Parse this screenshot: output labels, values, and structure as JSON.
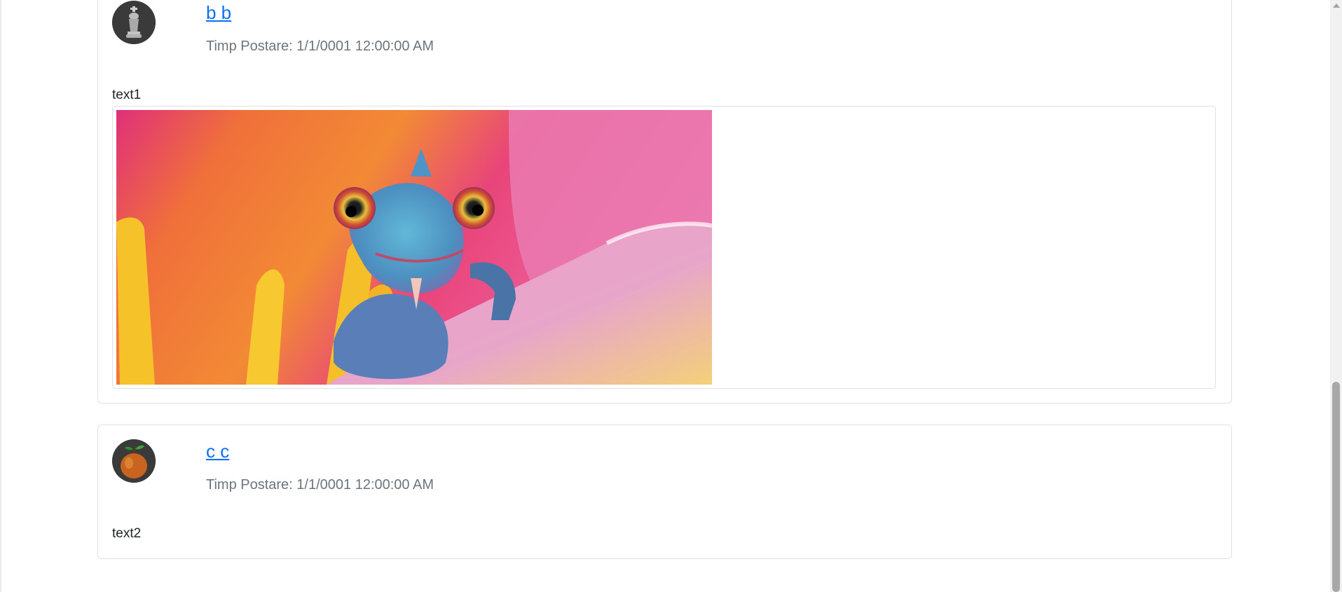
{
  "posts": [
    {
      "author": "b b",
      "timestamp": "Timp Postare: 1/1/0001 12:00:00 AM",
      "text": "text1",
      "avatar_icon": "chess-king-avatar",
      "has_image": true,
      "image_subject": "chameleon-on-flower-petal"
    },
    {
      "author": "c c",
      "timestamp": "Timp Postare: 1/1/0001 12:00:00 AM",
      "text": "text2",
      "avatar_icon": "peach-avatar",
      "has_image": false
    }
  ],
  "colors": {
    "link": "#0d6efd",
    "muted": "#6c757d",
    "border": "#dee2e6",
    "text": "#212529"
  }
}
